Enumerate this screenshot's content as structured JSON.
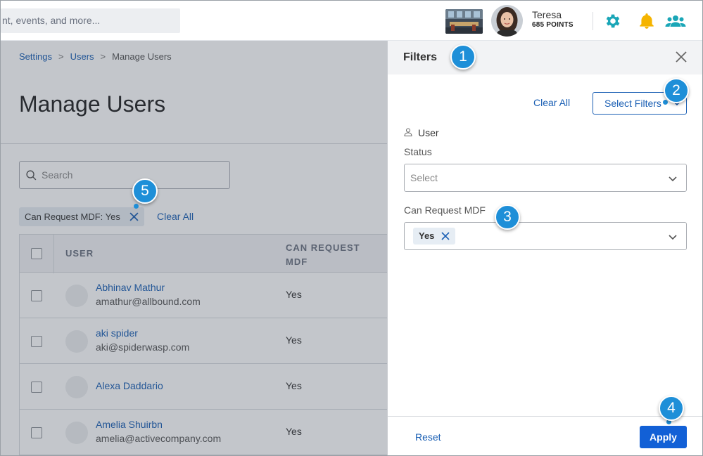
{
  "header": {
    "search_placeholder": "nt, events, and more...",
    "user_name": "Teresa",
    "user_points": "685 POINTS",
    "icons": [
      "settings-gear-icon",
      "notification-bell-icon",
      "community-users-icon"
    ],
    "colors": {
      "settings": "#1aa6b7",
      "bell": "#f5b400",
      "community": "#1aa6b7"
    }
  },
  "breadcrumb": {
    "items": [
      "Settings",
      "Users",
      "Manage Users"
    ],
    "separator": ">"
  },
  "page": {
    "title": "Manage Users"
  },
  "search": {
    "placeholder": "Search"
  },
  "active_filter": {
    "chip_label": "Can Request MDF: Yes",
    "clear_all": "Clear All"
  },
  "table": {
    "headers": [
      "USER",
      "CAN REQUEST MDF"
    ],
    "rows": [
      {
        "name": "Abhinav Mathur",
        "email": "amathur@allbound.com",
        "can_request_mdf": "Yes"
      },
      {
        "name": "aki spider",
        "email": "aki@spiderwasp.com",
        "can_request_mdf": "Yes"
      },
      {
        "name": "Alexa Daddario",
        "email": "",
        "can_request_mdf": "Yes"
      },
      {
        "name": "Amelia Shuirbn",
        "email": "amelia@activecompany.com",
        "can_request_mdf": "Yes"
      }
    ]
  },
  "filters_panel": {
    "title": "Filters",
    "clear_all": "Clear All",
    "select_filters": "Select Filters",
    "user_section_label": "User",
    "status_label": "Status",
    "status_placeholder": "Select",
    "mdf_label": "Can Request MDF",
    "mdf_selected": "Yes",
    "reset": "Reset",
    "apply": "Apply",
    "accent": "#1260d6"
  },
  "callouts": [
    "1",
    "2",
    "3",
    "4",
    "5"
  ]
}
